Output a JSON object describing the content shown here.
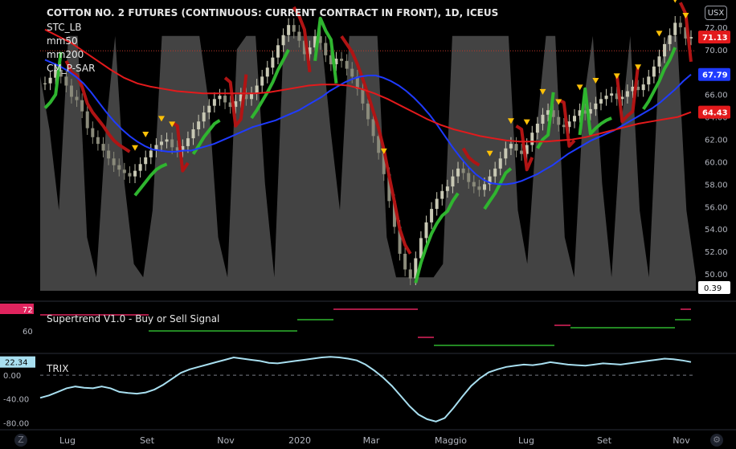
{
  "header": {
    "title": "COTTON NO. 2 FUTURES (CONTINUOUS: CURRENT CONTRACT IN FRONT), 1D, ICEUS",
    "currency_button": "USX",
    "indicators": [
      "STC_LB",
      "mm50",
      "mm200",
      "CM_P-SAR"
    ]
  },
  "subpanels": {
    "supertrend_label": "Supertrend V1.0 - Buy or Sell Signal",
    "trix_label": "TRIX"
  },
  "colors": {
    "background": "#000000",
    "up_candle": "#c8c8b4",
    "stc_fill": "#5a5a5a",
    "mm50": "#1f3bff",
    "mm200": "#e31a1c",
    "sar_bull": "#2fb52f",
    "sar_bear": "#b01414",
    "signal_marker": "#ffc107",
    "trix": "#a8dff0",
    "supertrend_up": "#2fb52f",
    "supertrend_down": "#e0245e"
  },
  "chart_data": [
    {
      "type": "candlestick",
      "title": "COTTON NO. 2 FUTURES (CONTINUOUS: CURRENT CONTRACT IN FRONT), 1D, ICEUS",
      "ylim": [
        48.5,
        73
      ],
      "y_ticks": [
        "50.00",
        "52.00",
        "54.00",
        "56.00",
        "58.00",
        "60.00",
        "62.00",
        "64.00",
        "66.00",
        "68.00",
        "70.00",
        "72.00"
      ],
      "x_ticks": [
        "Lug",
        "Set",
        "Nov",
        "2020",
        "Mar",
        "Maggio",
        "Lug",
        "Set",
        "Nov"
      ],
      "price_close": [
        67.0,
        67.5,
        68.2,
        67.6,
        66.8,
        65.8,
        65.5,
        64.5,
        63.0,
        62.2,
        61.6,
        61.0,
        60.3,
        59.7,
        59.3,
        59.0,
        58.7,
        59.2,
        59.8,
        60.4,
        61.0,
        61.5,
        61.8,
        62.0,
        61.3,
        61.0,
        61.4,
        62.1,
        62.9,
        63.6,
        64.4,
        65.0,
        65.6,
        65.9,
        65.3,
        64.9,
        65.4,
        66.0,
        65.6,
        66.1,
        66.8,
        67.6,
        68.4,
        69.3,
        70.4,
        71.3,
        72.2,
        71.6,
        70.8,
        69.6,
        70.2,
        71.2,
        70.6,
        69.5,
        68.7,
        69.2,
        69.0,
        68.3,
        67.6,
        66.5,
        65.2,
        63.8,
        62.3,
        60.8,
        58.9,
        56.5,
        54.2,
        51.8,
        50.4,
        49.6,
        51.4,
        53.2,
        54.6,
        55.8,
        56.7,
        57.4,
        57.8,
        58.7,
        59.4,
        59.0,
        58.2,
        57.8,
        57.5,
        58.0,
        58.7,
        59.4,
        60.3,
        61.2,
        61.6,
        61.0,
        60.7,
        61.5,
        62.6,
        63.4,
        64.2,
        64.6,
        64.0,
        63.3,
        63.1,
        63.6,
        64.1,
        64.6,
        64.3,
        64.7,
        65.2,
        65.6,
        65.9,
        66.1,
        65.6,
        65.8,
        66.3,
        66.7,
        66.4,
        66.9,
        67.6,
        68.5,
        69.4,
        70.5,
        71.3,
        72.4,
        72.0,
        71.0,
        71.13
      ],
      "series": [
        {
          "name": "mm50",
          "values": [
            69.1,
            68.8,
            68.5,
            68.1,
            67.6,
            67.0,
            66.2,
            65.3,
            64.4,
            63.6,
            62.9,
            62.3,
            61.8,
            61.4,
            61.1,
            61.0,
            60.9,
            60.9,
            61.0,
            61.0,
            61.2,
            61.4,
            61.6,
            61.9,
            62.2,
            62.5,
            62.8,
            63.1,
            63.3,
            63.5,
            63.7,
            64.0,
            64.3,
            64.6,
            65.0,
            65.4,
            65.8,
            66.3,
            66.7,
            67.1,
            67.4,
            67.6,
            67.7,
            67.7,
            67.5,
            67.2,
            66.8,
            66.3,
            65.7,
            65.0,
            64.2,
            63.3,
            62.3,
            61.3,
            60.4,
            59.6,
            58.9,
            58.4,
            58.1,
            58.0,
            58.0,
            58.1,
            58.3,
            58.6,
            58.9,
            59.3,
            59.7,
            60.2,
            60.7,
            61.1,
            61.5,
            61.9,
            62.2,
            62.5,
            62.8,
            63.2,
            63.6,
            64.0,
            64.4,
            64.8,
            65.3,
            65.9,
            66.5,
            67.2,
            67.79
          ]
        },
        {
          "name": "mm200",
          "values": [
            71.8,
            71.2,
            70.6,
            69.8,
            69.0,
            68.2,
            67.5,
            67.0,
            66.7,
            66.5,
            66.3,
            66.2,
            66.1,
            66.1,
            66.1,
            66.1,
            66.1,
            66.2,
            66.4,
            66.6,
            66.8,
            66.9,
            66.9,
            66.8,
            66.5,
            66.1,
            65.6,
            65.0,
            64.4,
            63.8,
            63.3,
            62.9,
            62.6,
            62.3,
            62.1,
            61.9,
            61.8,
            61.8,
            61.8,
            61.9,
            62.0,
            62.2,
            62.5,
            62.8,
            63.1,
            63.4,
            63.6,
            63.8,
            64.0,
            64.43
          ]
        }
      ],
      "last_labels": [
        "71.13",
        "67.79",
        "64.43"
      ],
      "stc_last": "0.39"
    },
    {
      "type": "line",
      "title": "Supertrend V1.0 - Buy or Sell Signal",
      "y_ticks": [
        "60"
      ],
      "last_value": "72"
    },
    {
      "type": "line",
      "title": "TRIX",
      "ylim": [
        -85,
        30
      ],
      "y_ticks": [
        "0.00",
        "-40.00",
        "-80.00"
      ],
      "values": [
        -38,
        -34,
        -28,
        -22,
        -19,
        -21,
        -22,
        -19,
        -22,
        -28,
        -30,
        -31,
        -29,
        -24,
        -16,
        -6,
        4,
        10,
        14,
        18,
        22,
        26,
        30,
        28,
        26,
        24,
        21,
        20,
        22,
        24,
        26,
        28,
        30,
        31,
        30,
        28,
        25,
        18,
        8,
        -4,
        -18,
        -35,
        -52,
        -66,
        -74,
        -78,
        -72,
        -55,
        -36,
        -18,
        -5,
        5,
        10,
        14,
        16,
        18,
        17,
        19,
        22,
        20,
        18,
        17,
        16,
        18,
        20,
        19,
        18,
        20,
        22,
        24,
        26,
        28,
        27,
        25,
        22.34
      ],
      "last_value": "22.34"
    }
  ]
}
